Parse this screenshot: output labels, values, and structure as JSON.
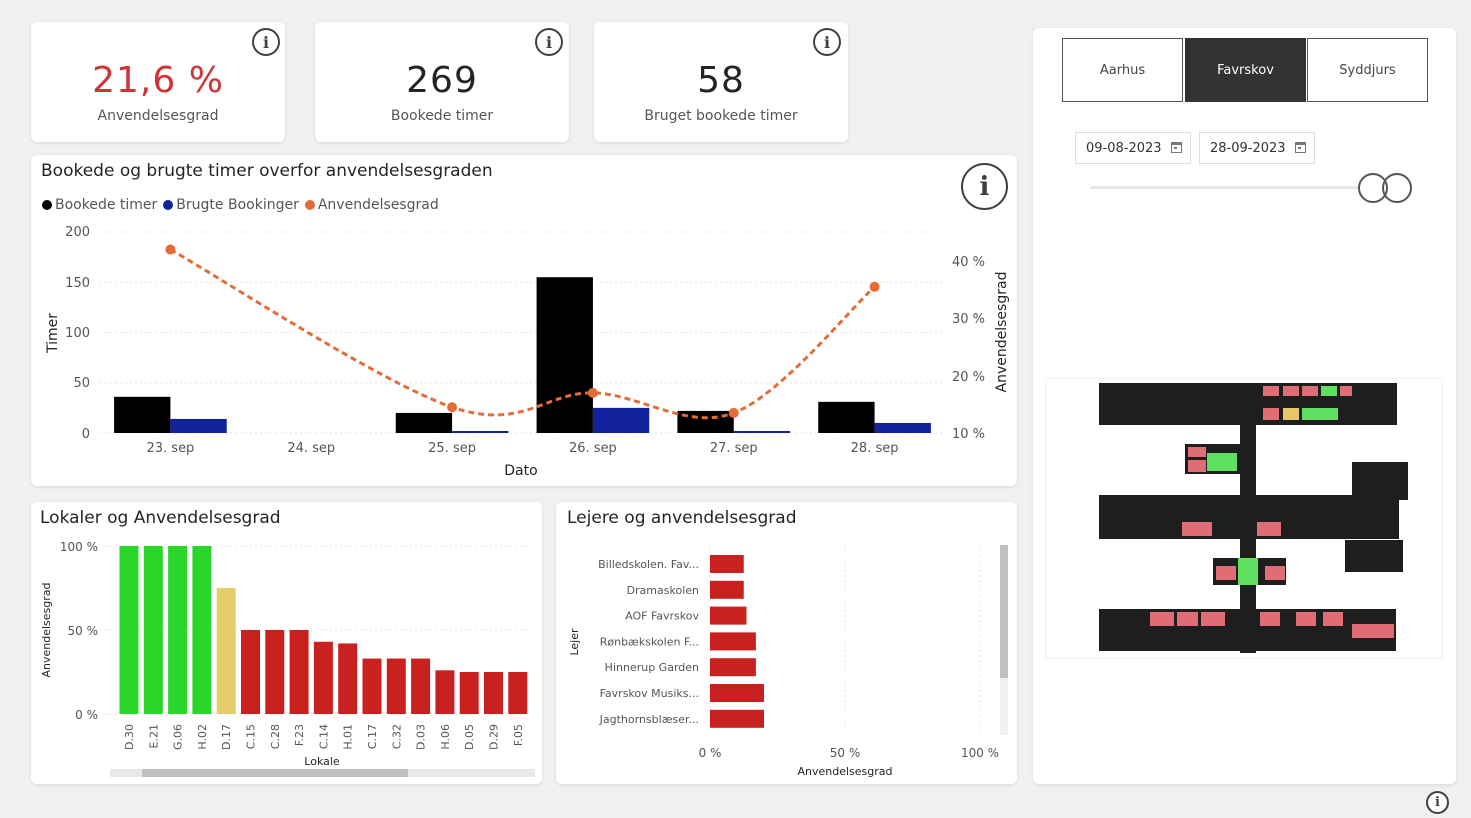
{
  "kpis": [
    {
      "value": "21,6 %",
      "label": "Anvendelsesgrad",
      "color": "#d13438"
    },
    {
      "value": "269",
      "label": "Bookede timer",
      "color": "#252423"
    },
    {
      "value": "58",
      "label": "Bruget bookede timer",
      "color": "#252423"
    }
  ],
  "info_icon": {
    "glyph": "i"
  },
  "combo_chart": {
    "title": "Bookede og brugte timer overfor anvendelsesgraden",
    "legend": [
      {
        "label": "Bookede timer",
        "color": "#000000"
      },
      {
        "label": "Brugte Bookinger",
        "color": "#12239e"
      },
      {
        "label": "Anvendelsesgrad",
        "color": "#e66c37"
      }
    ],
    "y_ticks": [
      "200",
      "150",
      "100",
      "50",
      "0"
    ],
    "y2_ticks": [
      "40 %",
      "30 %",
      "20 %",
      "10 %"
    ]
  },
  "lokaler_chart": {
    "title": "Lokaler og Anvendelsesgrad",
    "y_ticks": [
      "100 %",
      "50 %",
      "0 %"
    ]
  },
  "lejere_chart": {
    "title": "Lejere og anvendelsesgrad",
    "x_ticks": [
      "0 %",
      "50 %",
      "100 %"
    ]
  },
  "slicer": {
    "buttons": [
      "Aarhus",
      "Favrskov",
      "Syddjurs"
    ],
    "selected": "Favrskov",
    "date_from": "09-08-2023",
    "date_to": "28-09-2023",
    "range_position": 1.0
  },
  "floorplan": {
    "icon": "floorplan-map",
    "status_colors": {
      "low": "#e06c75",
      "mid": "#e5c765",
      "high": "#5fe05f"
    }
  },
  "chart_data": [
    {
      "type": "bar",
      "title": "Bookede og brugte timer overfor anvendelsesgraden",
      "categories": [
        "23. sep",
        "24. sep",
        "25. sep",
        "26. sep",
        "27. sep",
        "28. sep"
      ],
      "series": [
        {
          "name": "Bookede timer",
          "axis": "left",
          "values": [
            36,
            0,
            20,
            155,
            22,
            31
          ]
        },
        {
          "name": "Brugte Bookinger",
          "axis": "left",
          "values": [
            14,
            0,
            2,
            25,
            2,
            10
          ]
        },
        {
          "name": "Anvendelsesgrad",
          "type": "line",
          "axis": "right",
          "values": [
            42,
            null,
            14.5,
            17,
            13.5,
            35.5
          ]
        }
      ],
      "xlabel": "Dato",
      "ylabel": "Timer",
      "y2label": "Anvendelsesgrad",
      "ylim": [
        0,
        200
      ],
      "y2lim": [
        10,
        45
      ],
      "legend": "top-left",
      "grid": true
    },
    {
      "type": "bar",
      "title": "Lokaler og Anvendelsesgrad",
      "categories": [
        "D.30",
        "E.21",
        "G.06",
        "H.02",
        "D.17",
        "C.15",
        "C.28",
        "F.23",
        "C.14",
        "H.01",
        "C.17",
        "C.32",
        "D.03",
        "H.06",
        "D.05",
        "D.29",
        "F.05"
      ],
      "values": [
        100,
        100,
        100,
        100,
        75,
        50,
        50,
        50,
        43,
        42,
        33,
        33,
        33,
        26,
        25,
        25,
        25
      ],
      "colors": [
        "#2bd62b",
        "#2bd62b",
        "#2bd62b",
        "#2bd62b",
        "#e5cd6b",
        "#c92020",
        "#c92020",
        "#c92020",
        "#c92020",
        "#c92020",
        "#c92020",
        "#c92020",
        "#c92020",
        "#c92020",
        "#c92020",
        "#c92020",
        "#c92020"
      ],
      "xlabel": "Lokale",
      "ylabel": "Anvendelsesgrad",
      "ylim": [
        0,
        100
      ],
      "grid": true
    },
    {
      "type": "bar",
      "orientation": "horizontal",
      "title": "Lejere og anvendelsesgrad",
      "categories": [
        "Billedskolen. Fav...",
        "Dramaskolen",
        "AOF Favrskov",
        "Rønbækskolen F...",
        "Hinnerup Garden",
        "Favrskov Musiks...",
        "Jagthornsblæser..."
      ],
      "values": [
        12.5,
        12.5,
        13.5,
        17,
        17,
        20,
        20
      ],
      "color": "#c92020",
      "xlabel": "Anvendelsesgrad",
      "ylabel": "Lejer",
      "xlim": [
        0,
        100
      ],
      "grid": true
    }
  ]
}
